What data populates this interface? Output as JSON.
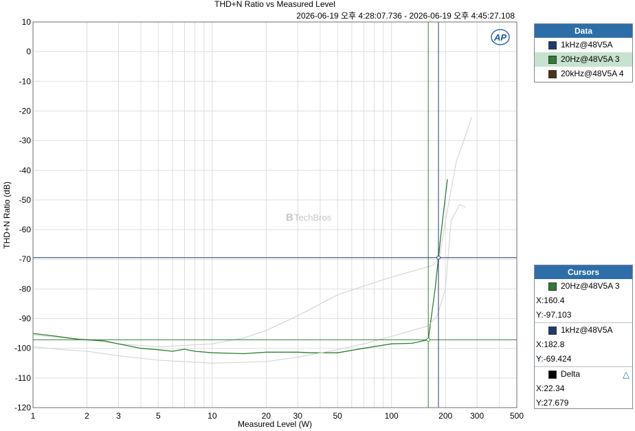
{
  "chart_data": {
    "type": "line",
    "title": "THD+N Ratio vs Measured Level",
    "subtitle": "2026-06-19 오후 4:28:07.736 - 2026-06-19 오후 4:45:27.108",
    "xlabel": "Measured Level (W)",
    "ylabel": "THD+N Ratio (dB)",
    "xscale": "log",
    "xlim": [
      1,
      500
    ],
    "ylim": [
      -120,
      10
    ],
    "xticks": [
      "1",
      "2",
      "3",
      "5",
      "10",
      "20",
      "30",
      "50",
      "100",
      "200",
      "300",
      "500"
    ],
    "xtick_values": [
      1,
      2,
      3,
      5,
      10,
      20,
      30,
      50,
      100,
      200,
      300,
      500
    ],
    "yticks": [
      "10",
      "0",
      "-10",
      "-20",
      "-30",
      "-40",
      "-50",
      "-60",
      "-70",
      "-80",
      "-90",
      "-100",
      "-110",
      "-120"
    ],
    "ytick_values": [
      10,
      0,
      -10,
      -20,
      -30,
      -40,
      -50,
      -60,
      -70,
      -80,
      -90,
      -100,
      -110,
      -120
    ],
    "grid": true,
    "watermark": "TechBros",
    "series": [
      {
        "name": "1kHz@48V5A",
        "color": "#d2d2d2",
        "points": [
          [
            1,
            -95.5
          ],
          [
            1.5,
            -96.5
          ],
          [
            2,
            -97
          ],
          [
            3,
            -98.5
          ],
          [
            5,
            -99.5
          ],
          [
            7,
            -99
          ],
          [
            10,
            -98.5
          ],
          [
            15,
            -96.5
          ],
          [
            20,
            -94
          ],
          [
            30,
            -89
          ],
          [
            50,
            -82
          ],
          [
            70,
            -79
          ],
          [
            100,
            -76
          ],
          [
            150,
            -73
          ],
          [
            170,
            -72
          ],
          [
            185,
            -69.5
          ],
          [
            200,
            -57
          ],
          [
            230,
            -37
          ],
          [
            260,
            -28
          ],
          [
            280,
            -22
          ]
        ]
      },
      {
        "name": "20Hz@48V5A 3",
        "color": "#2e7d32",
        "points": [
          [
            1,
            -95
          ],
          [
            1.3,
            -95.8
          ],
          [
            1.8,
            -97
          ],
          [
            2.5,
            -97.5
          ],
          [
            3,
            -98.5
          ],
          [
            4,
            -100
          ],
          [
            5,
            -100.5
          ],
          [
            6,
            -101
          ],
          [
            7,
            -100.3
          ],
          [
            8,
            -101
          ],
          [
            10,
            -101.5
          ],
          [
            15,
            -101.8
          ],
          [
            20,
            -101.3
          ],
          [
            30,
            -101.3
          ],
          [
            35,
            -101.5
          ],
          [
            50,
            -101.5
          ],
          [
            70,
            -100
          ],
          [
            100,
            -98.5
          ],
          [
            130,
            -98.3
          ],
          [
            160.4,
            -97.1
          ],
          [
            175,
            -80
          ],
          [
            190,
            -60
          ],
          [
            205,
            -43
          ]
        ]
      },
      {
        "name": "20kHz@48V5A 4",
        "color": "#d2d2d2",
        "points": [
          [
            1,
            -99.5
          ],
          [
            1.5,
            -100.5
          ],
          [
            2,
            -101
          ],
          [
            3,
            -102.5
          ],
          [
            5,
            -104
          ],
          [
            7,
            -104.5
          ],
          [
            10,
            -105
          ],
          [
            20,
            -104.5
          ],
          [
            30,
            -103
          ],
          [
            50,
            -100.5
          ],
          [
            70,
            -98.5
          ],
          [
            100,
            -96
          ],
          [
            130,
            -94
          ],
          [
            160,
            -92.5
          ],
          [
            180,
            -89
          ],
          [
            200,
            -80
          ],
          [
            215,
            -57
          ],
          [
            240,
            -51.5
          ],
          [
            260,
            -52.5
          ]
        ]
      }
    ],
    "cursors": [
      {
        "name": "20Hz@48V5A 3",
        "x": 160.4,
        "y": -97.103,
        "color": "#2e7d32"
      },
      {
        "name": "1kHz@48V5A",
        "x": 182.8,
        "y": -69.424,
        "color": "#1f3a6e"
      }
    ]
  },
  "legend": {
    "title": "Data",
    "items": [
      {
        "label": "1kHz@48V5A",
        "color": "#1f3a6e"
      },
      {
        "label": "20Hz@48V5A 3",
        "color": "#2e7d32"
      },
      {
        "label": "20kHz@48V5A 4",
        "color": "#4a3414"
      }
    ]
  },
  "cursors_panel": {
    "title": "Cursors",
    "cursor1": {
      "name": "20Hz@48V5A 3",
      "color": "#2e7d32",
      "x": "X:160.4",
      "y": "Y:-97.103"
    },
    "cursor2": {
      "name": "1kHz@48V5A",
      "color": "#1f3a6e",
      "x": "X:182.8",
      "y": "Y:-69.424"
    },
    "delta": {
      "name": "Delta",
      "color": "#000000",
      "x": "X:22.34",
      "y": "Y:27.679"
    }
  },
  "logo": "AP"
}
